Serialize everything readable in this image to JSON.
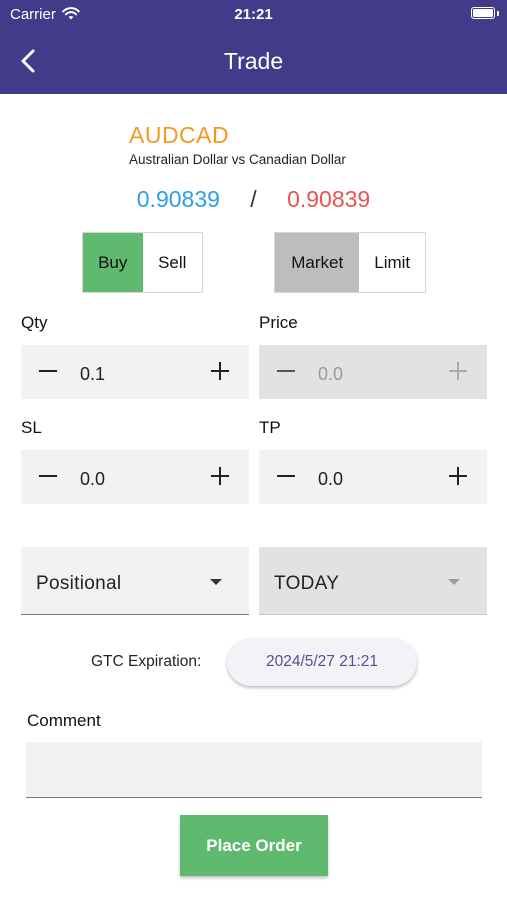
{
  "status_bar": {
    "carrier": "Carrier",
    "time": "21:21"
  },
  "nav": {
    "title": "Trade",
    "back_icon": "chevron-left-icon"
  },
  "instrument": {
    "symbol": "AUDCAD",
    "description": "Australian Dollar vs Canadian Dollar",
    "bid": "0.90839",
    "separator": "/",
    "ask": "0.90839"
  },
  "side_toggle": {
    "buy": "Buy",
    "sell": "Sell",
    "selected": "Buy"
  },
  "order_type_toggle": {
    "market": "Market",
    "limit": "Limit",
    "selected": "Market"
  },
  "fields": {
    "qty": {
      "label": "Qty",
      "value": "0.1"
    },
    "price": {
      "label": "Price",
      "value": "0.0"
    },
    "sl": {
      "label": "SL",
      "value": "0.0"
    },
    "tp": {
      "label": "TP",
      "value": "0.0"
    }
  },
  "selects": {
    "position_type": "Positional",
    "validity": "TODAY"
  },
  "gtc": {
    "label": "GTC Expiration:",
    "value": "2024/5/27 21:21"
  },
  "comment": {
    "label": "Comment",
    "value": "",
    "placeholder": ""
  },
  "actions": {
    "place_order": "Place Order"
  },
  "colors": {
    "header": "#443a8a",
    "symbol": "#f29a1e",
    "bid": "#2e9ee8",
    "ask": "#e8554e",
    "buy_active": "#5fb96e",
    "market_active": "#bdbdbd",
    "place_order": "#5fb96e"
  }
}
